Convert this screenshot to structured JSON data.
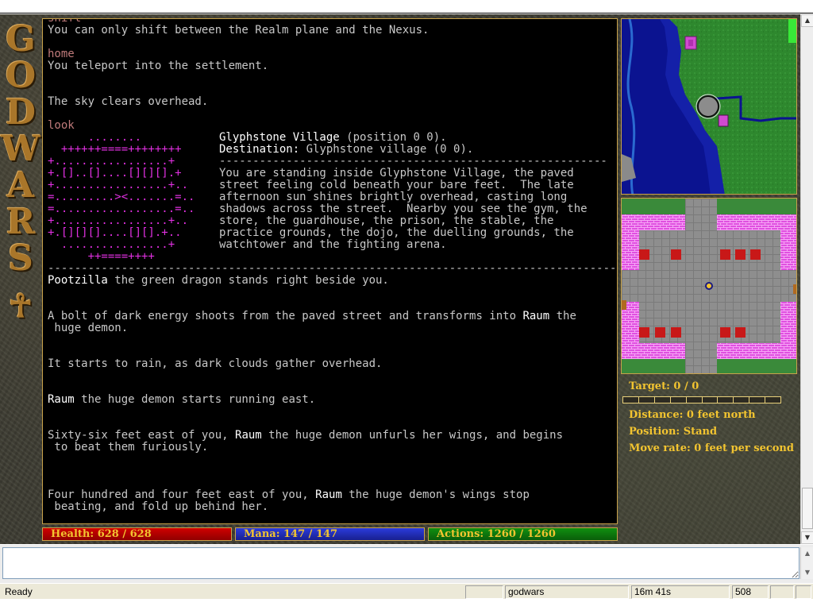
{
  "logo": {
    "letters": [
      "G",
      "O",
      "D",
      "W",
      "A",
      "R",
      "S"
    ],
    "emblem": "☥"
  },
  "output": {
    "pre_lines": [
      {
        "t": "shift",
        "c": "cmd"
      },
      {
        "t": "You can only shift between the Realm plane and the Nexus.",
        "c": ""
      },
      {
        "t": "",
        "c": ""
      },
      {
        "t": "home",
        "c": "cmd"
      },
      {
        "t": "You teleport into the settlement.",
        "c": ""
      },
      {
        "t": "",
        "c": ""
      },
      {
        "t": "",
        "c": ""
      },
      {
        "t": "The sky clears overhead.",
        "c": ""
      },
      {
        "t": "",
        "c": ""
      },
      {
        "t": "look",
        "c": "cmd"
      }
    ],
    "ascii_map": [
      "      ........",
      "  ++++++====++++++++",
      "+.................+",
      "+.[]..[]....[][][].+",
      "+.................+..",
      "=.........><.......=..",
      "=..................=..",
      "+.................+..",
      "+.[][][]....[][].+..",
      "  ................+",
      "      ++====++++"
    ],
    "room": {
      "name": "Glyphstone Village",
      "position": "(position 0 0).",
      "dest_label": "Destination:",
      "dest_value": "Glyphstone village (0 0).",
      "divider": "----------------------------------------------------------",
      "description": [
        "You are standing inside Glyphstone Village, the paved",
        "street feeling cold beneath your bare feet.  The late",
        "afternoon sun shines brightly overhead, casting long",
        "shadows across the street.  Nearby you see the gym, the",
        "store, the guardhouse, the prison, the stable, the",
        "practice grounds, the dojo, the duelling grounds, the",
        "watchtower and the fighting arena."
      ]
    },
    "full_divider": "-----------------------------------------------------------------------------------------------",
    "post_lines": [
      {
        "b": "Pootzilla",
        "t": " the green dragon stands right beside you."
      },
      {
        "b": "",
        "t": ""
      },
      {
        "b": "",
        "t": ""
      },
      {
        "b": "",
        "t": "A bolt of dark energy shoots from the paved street and transforms into ",
        "b2": "Raum",
        "t2": " the"
      },
      {
        "b": "",
        "t": " huge demon."
      },
      {
        "b": "",
        "t": ""
      },
      {
        "b": "",
        "t": ""
      },
      {
        "b": "",
        "t": "It starts to rain, as dark clouds gather overhead."
      },
      {
        "b": "",
        "t": ""
      },
      {
        "b": "",
        "t": ""
      },
      {
        "b": "Raum",
        "t": " the huge demon starts running east."
      },
      {
        "b": "",
        "t": ""
      },
      {
        "b": "",
        "t": ""
      },
      {
        "b": "",
        "t": "Sixty-six feet east of you, ",
        "b2": "Raum",
        "t2": " the huge demon unfurls her wings, and begins"
      },
      {
        "b": "",
        "t": " to beat them furiously."
      },
      {
        "b": "",
        "t": ""
      },
      {
        "b": "",
        "t": ""
      },
      {
        "b": "",
        "t": ""
      },
      {
        "b": "",
        "t": "Four hundred and four feet east of you, ",
        "b2": "Raum",
        "t2": " the huge demon's wings stop"
      },
      {
        "b": "",
        "t": " beating, and fold up behind her."
      }
    ]
  },
  "info": {
    "target": "Target: 0 / 0",
    "distance": "Distance: 0 feet north",
    "position": "Position: Stand",
    "move_rate": "Move rate: 0 feet per second"
  },
  "bars": {
    "health": "Health: 628 / 628",
    "mana": "Mana: 147 / 147",
    "actions": "Actions: 1260 / 1260"
  },
  "input": {
    "value": ""
  },
  "status": {
    "ready": "Ready",
    "world": "godwars",
    "time": "16m 41s",
    "count": "508"
  },
  "colors": {
    "frame_gold": "#c8a24a",
    "info_text": "#f2c430",
    "command_echo": "#c07b7b",
    "map_magenta": "#e030e0",
    "health": "#d00000",
    "mana": "#2b3bdc",
    "actions": "#109010"
  }
}
